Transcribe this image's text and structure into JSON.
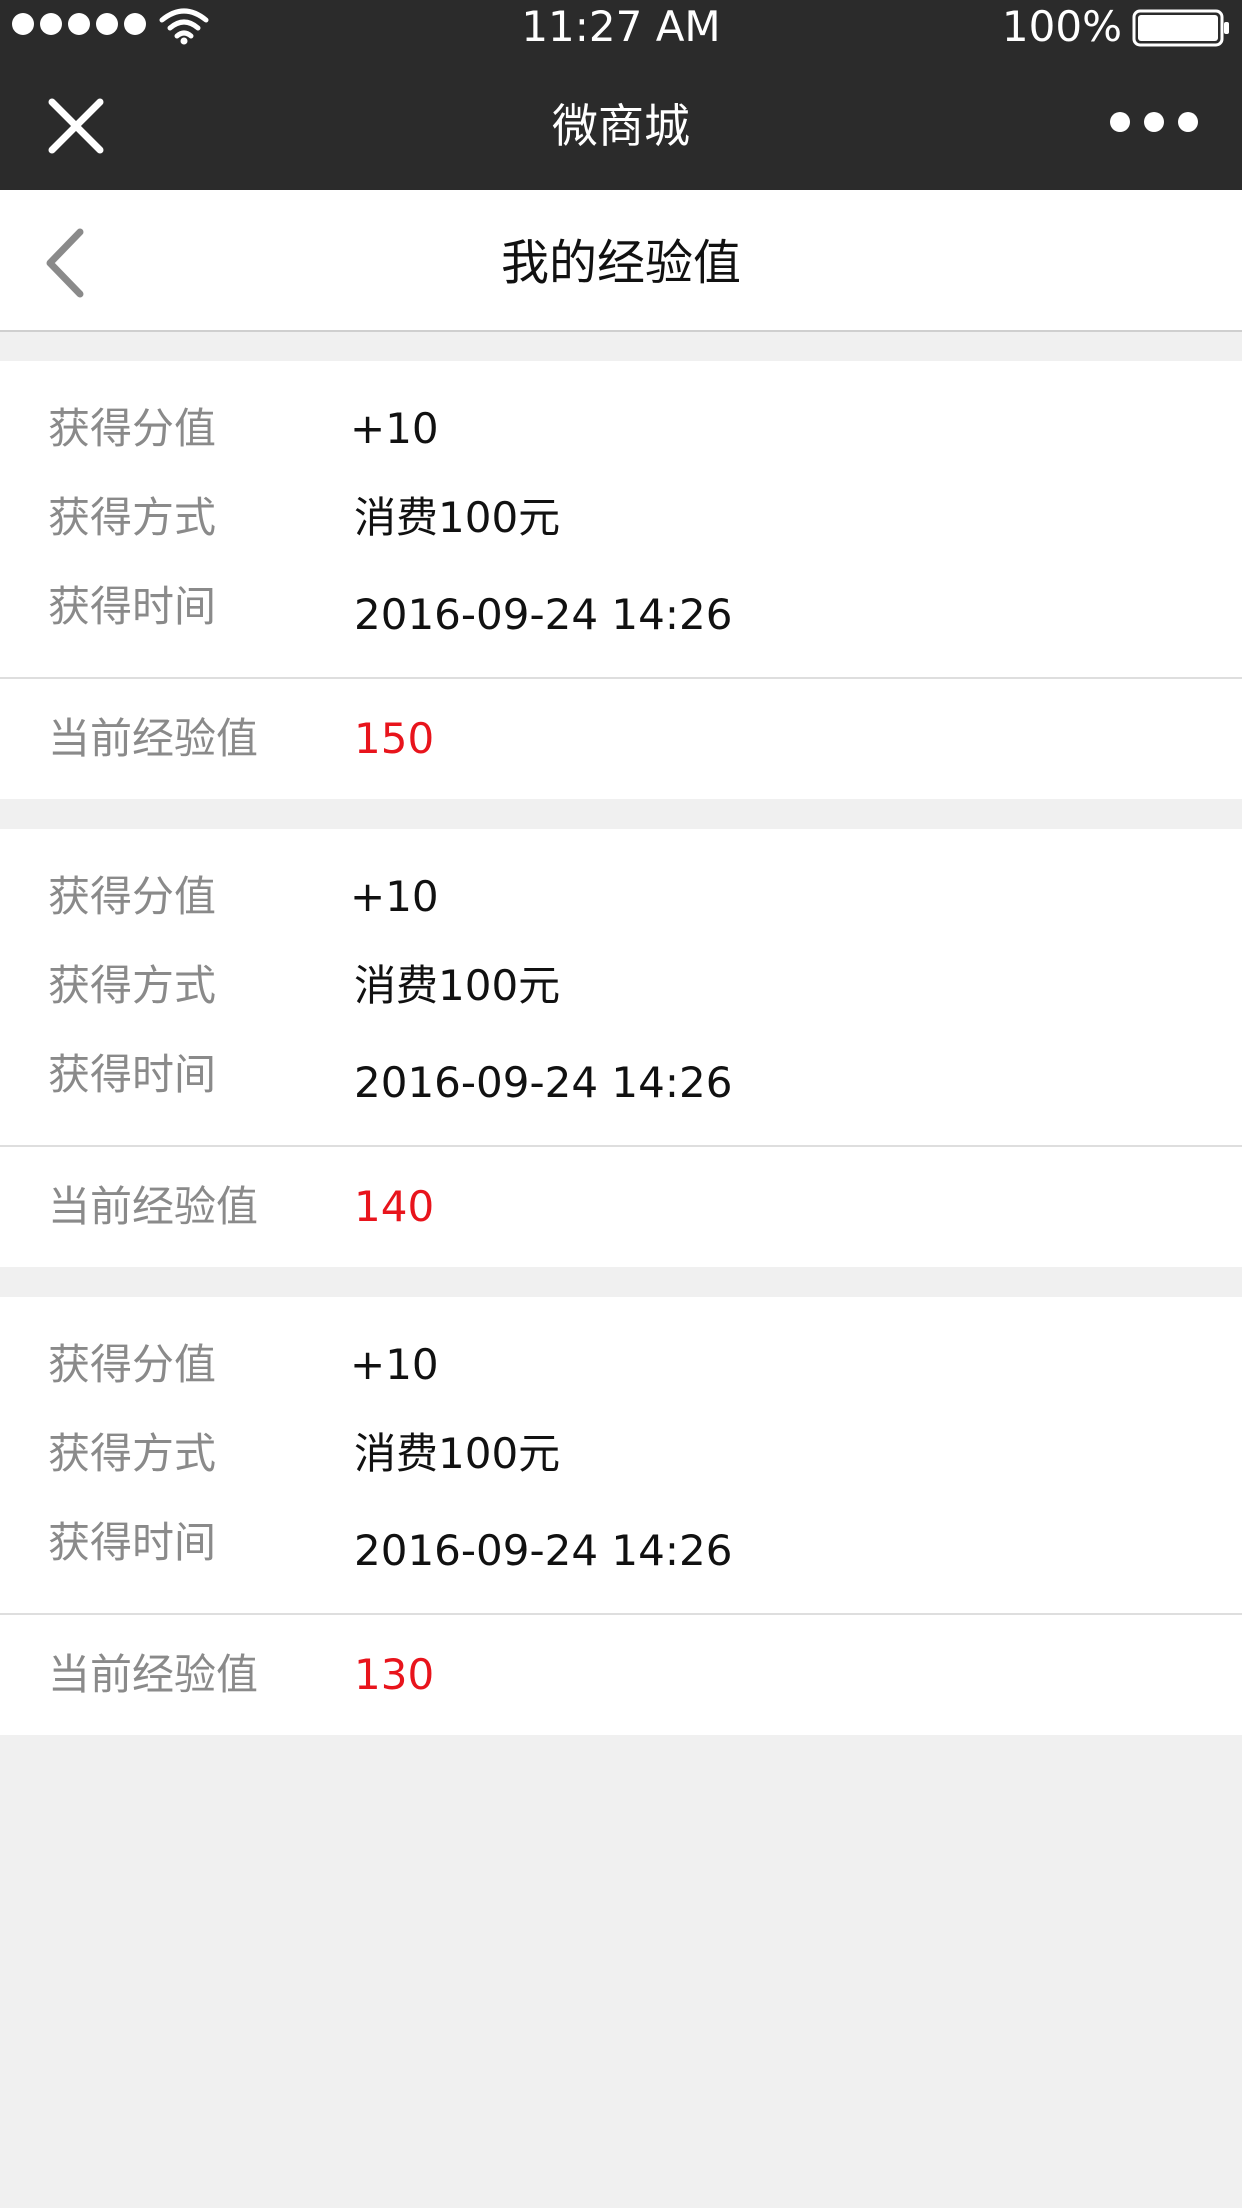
{
  "status_bar": {
    "time": "11:27 AM",
    "battery": "100%",
    "signal_icon": "signal-dots-icon",
    "wifi_icon": "wifi-icon",
    "battery_icon": "battery-icon"
  },
  "nav": {
    "title": "微商城",
    "close_icon": "close-icon",
    "more_icon": "more-icon"
  },
  "header": {
    "title": "我的经验值",
    "back_icon": "chevron-left-icon"
  },
  "labels": {
    "points": "获得分值",
    "method": "获得方式",
    "time": "获得时间",
    "current": "当前经验值"
  },
  "records": [
    {
      "points": "+10",
      "method": "消费100元",
      "time": "2016-09-24  14:26",
      "current": "150"
    },
    {
      "points": "+10",
      "method": "消费100元",
      "time": "2016-09-24  14:26",
      "current": "140"
    },
    {
      "points": "+10",
      "method": "消费100元",
      "time": "2016-09-24  14:26",
      "current": "130"
    }
  ],
  "colors": {
    "bar_background": "#2b2b2b",
    "accent_red": "#e8141c",
    "label_gray": "#8a8a8a",
    "page_background": "#f0f0f0"
  }
}
